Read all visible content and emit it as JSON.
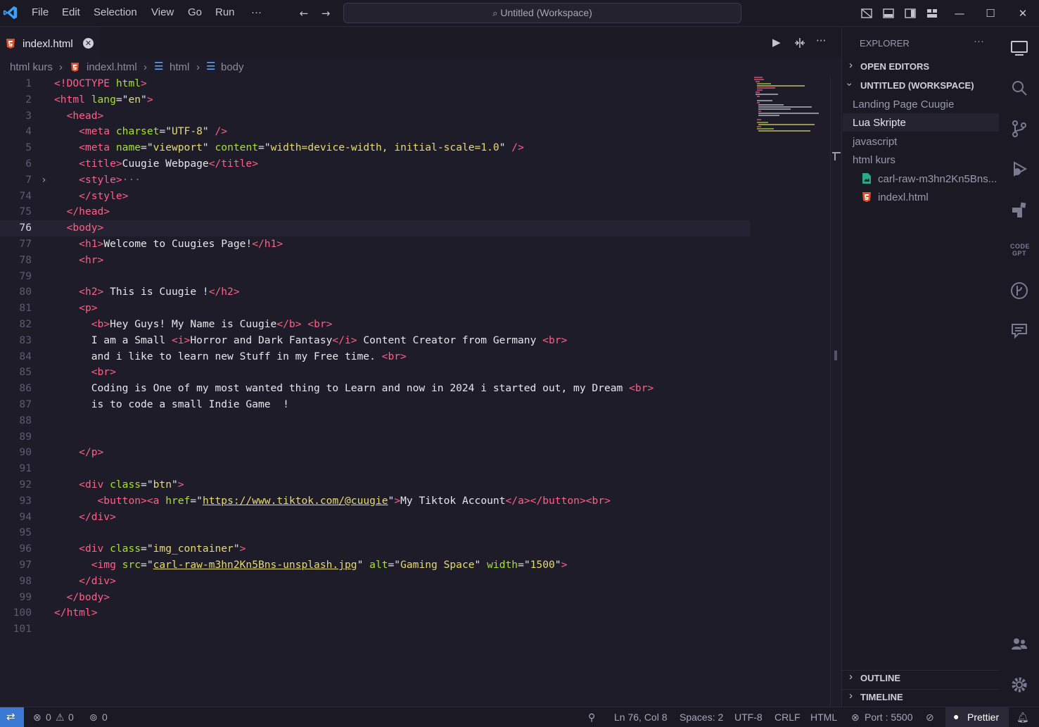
{
  "titlebar": {
    "menu": [
      "File",
      "Edit",
      "Selection",
      "View",
      "Go",
      "Run",
      "···"
    ],
    "command_center": "Untitled (Workspace)",
    "icons": [
      "back-arrow-icon",
      "forward-arrow-icon",
      "toggle-panel-icon",
      "toggle-secondary-icon",
      "toggle-sidebar-icon",
      "layout-icon",
      "minimize-icon",
      "maximize-icon",
      "close-icon"
    ]
  },
  "tab": {
    "label": "indexl.html",
    "icon": "html5-icon",
    "accent": "#e44d26"
  },
  "editor_actions": [
    "run-icon",
    "split-diff-icon",
    "more-actions-icon"
  ],
  "breadcrumb": {
    "items": [
      "html kurs",
      "indexl.html",
      "html",
      "body"
    ]
  },
  "code": {
    "cursor_line": 76,
    "lines": [
      {
        "n": "1",
        "c": "<!DOCTYPE html>"
      },
      {
        "n": "2",
        "c": "<html lang=\"en\">"
      },
      {
        "n": "3",
        "c": "  <head>"
      },
      {
        "n": "4",
        "c": "    <meta charset=\"UTF-8\" />"
      },
      {
        "n": "5",
        "c": "    <meta name=\"viewport\" content=\"width=device-width, initial-scale=1.0\" />"
      },
      {
        "n": "6",
        "c": "    <title>Cuugie Webpage</title>"
      },
      {
        "n": "7",
        "c": "    <style>···"
      },
      {
        "n": "74",
        "c": "    </style>"
      },
      {
        "n": "75",
        "c": "  </head>"
      },
      {
        "n": "76",
        "c": "  <body>"
      },
      {
        "n": "77",
        "c": "    <h1>Welcome to Cuugies Page!</h1>"
      },
      {
        "n": "78",
        "c": "    <hr>"
      },
      {
        "n": "79",
        "c": ""
      },
      {
        "n": "80",
        "c": "    <h2> This is Cuugie !</h2>"
      },
      {
        "n": "81",
        "c": "    <p>"
      },
      {
        "n": "82",
        "c": "      <b>Hey Guys! My Name is Cuugie</b> <br>"
      },
      {
        "n": "83",
        "c": "      I am a Small <i>Horror and Dark Fantasy</i> Content Creator from Germany <br>"
      },
      {
        "n": "84",
        "c": "      and i like to learn new Stuff in my Free time. <br>"
      },
      {
        "n": "85",
        "c": "      <br>"
      },
      {
        "n": "86",
        "c": "      Coding is One of my most wanted thing to Learn and now in 2024 i started out, my Dream <br>"
      },
      {
        "n": "87",
        "c": "      is to code a small Indie Game  !"
      },
      {
        "n": "88",
        "c": ""
      },
      {
        "n": "89",
        "c": ""
      },
      {
        "n": "90",
        "c": "    </p>"
      },
      {
        "n": "91",
        "c": ""
      },
      {
        "n": "92",
        "c": "    <div class=\"btn\">"
      },
      {
        "n": "93",
        "c": "       <button><a href=\"https://www.tiktok.com/@cuugie\">My Tiktok Account</a></button><br>"
      },
      {
        "n": "94",
        "c": "    </div>"
      },
      {
        "n": "95",
        "c": ""
      },
      {
        "n": "96",
        "c": "    <div class=\"img_container\">"
      },
      {
        "n": "97",
        "c": "      <img src=\"carl-raw-m3hn2Kn5Bns-unsplash.jpg\" alt=\"Gaming Space\" width=\"1500\">"
      },
      {
        "n": "98",
        "c": "    </div>"
      },
      {
        "n": "99",
        "c": "  </body>"
      },
      {
        "n": "100",
        "c": "</html>"
      },
      {
        "n": "101",
        "c": ""
      }
    ]
  },
  "sidebar": {
    "title": "EXPLORER",
    "more": "···",
    "open_editors": "OPEN EDITORS",
    "workspace": "UNTITLED (WORKSPACE)",
    "items": [
      {
        "label": "Landing Page Cuugie"
      },
      {
        "label": "Lua Skripte"
      },
      {
        "label": "javascript"
      },
      {
        "label": "html kurs"
      },
      {
        "label": "carl-raw-m3hn2Kn5Bns..."
      },
      {
        "label": "indexl.html"
      }
    ],
    "outline": "OUTLINE",
    "timeline": "TIMELINE"
  },
  "activity_bar": [
    "remote-explorer-icon",
    "search-icon",
    "source-control-icon",
    "run-debug-icon",
    "extensions-icon",
    "codegpt-icon",
    "git-graph-icon",
    "chat-icon",
    "accounts-icon",
    "settings-icon"
  ],
  "codegpt_label": "CODE GPT",
  "statusbar": {
    "errors": "0",
    "warnings": "0",
    "ports": "0",
    "position": "Ln 76, Col 8",
    "spaces": "Spaces: 2",
    "encoding": "UTF-8",
    "eol": "CRLF",
    "language": "HTML",
    "port": "Port : 5500",
    "prettier": "Prettier"
  }
}
